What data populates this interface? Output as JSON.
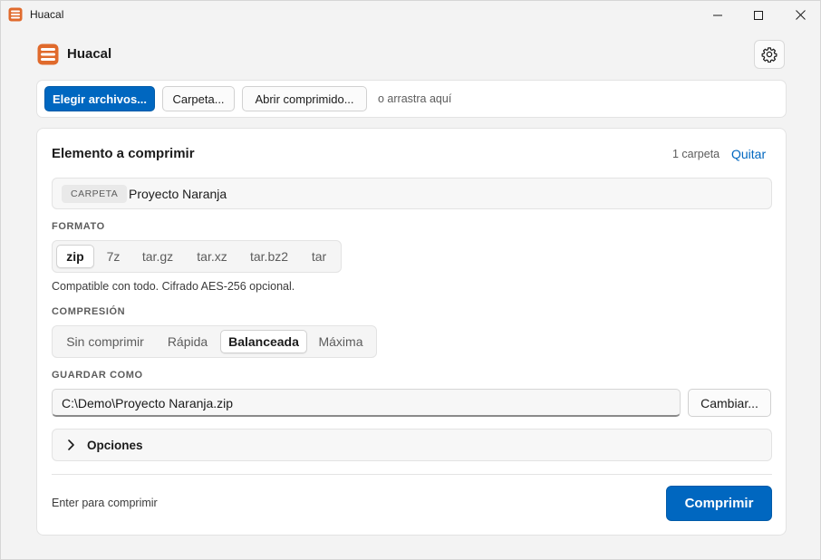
{
  "window": {
    "title": "Huacal",
    "icon": "crate-icon"
  },
  "header": {
    "app_name": "Huacal",
    "settings_icon": "gear-icon"
  },
  "toolbar": {
    "choose_files": "Elegir archivos...",
    "folder": "Carpeta...",
    "open_archive": "Abrir comprimido...",
    "drop_hint": "o arrastra aquí"
  },
  "card": {
    "title": "Elemento a comprimir",
    "count": "1 carpeta",
    "remove": "Quitar",
    "item": {
      "tag": "CARPETA",
      "name": "Proyecto Naranja"
    },
    "format": {
      "label": "FORMATO",
      "options": [
        "zip",
        "7z",
        "tar.gz",
        "tar.xz",
        "tar.bz2",
        "tar"
      ],
      "selected": "zip",
      "description": "Compatible con todo. Cifrado AES-256 opcional."
    },
    "compression": {
      "label": "COMPRESIÓN",
      "options": [
        "Sin comprimir",
        "Rápida",
        "Balanceada",
        "Máxima"
      ],
      "selected": "Balanceada"
    },
    "save_as": {
      "label": "GUARDAR COMO",
      "path": "C:\\Demo\\Proyecto Naranja.zip",
      "change": "Cambiar..."
    },
    "options": {
      "label": "Opciones"
    },
    "footer": {
      "hint": "Enter para comprimir",
      "compress": "Comprimir"
    }
  },
  "colors": {
    "accent": "#0067c0",
    "logo": "#e06a2c"
  }
}
